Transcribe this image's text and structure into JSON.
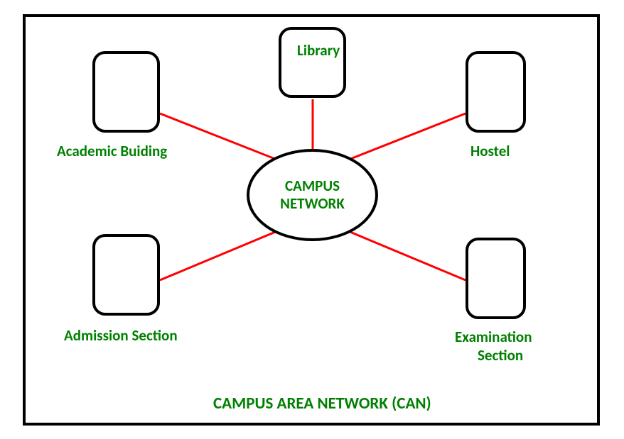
{
  "diagram": {
    "title": "CAMPUS AREA NETWORK (CAN)",
    "center": "CAMPUS NETWORK",
    "nodes": {
      "academic": "Academic Buiding",
      "library": "Library",
      "hostel": "Hostel",
      "admission": "Admission Section",
      "examination_line1": "Examination",
      "examination_line2": "Section"
    }
  }
}
